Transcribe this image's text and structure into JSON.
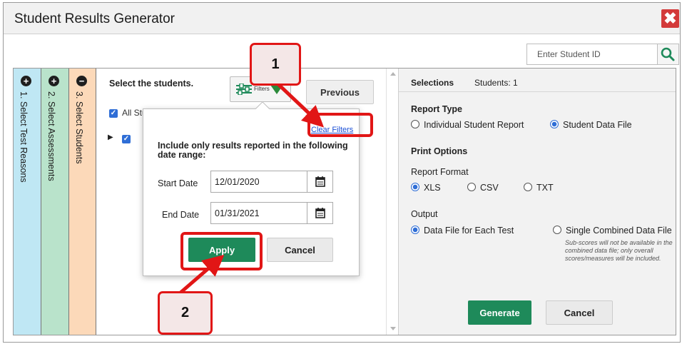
{
  "dialog": {
    "title": "Student Results Generator",
    "close_symbol": "✖"
  },
  "search": {
    "placeholder": "Enter Student ID"
  },
  "steps": [
    {
      "icon": "plus-icon",
      "symbol": "+",
      "label": "1. Select Test Reasons",
      "color": "#bfe7f4"
    },
    {
      "icon": "plus-icon",
      "symbol": "+",
      "label": "2. Select Assessments",
      "color": "#b9e3cb"
    },
    {
      "icon": "minus-icon",
      "symbol": "−",
      "label": "3. Select Students",
      "color": "#fcd9b9"
    }
  ],
  "students": {
    "title": "Select the students.",
    "filter_label": "Filters",
    "previous_label": "Previous",
    "all_students_label": "All Students"
  },
  "filter_popup": {
    "clear_filters": "Clear Filters",
    "include_text": "Include only results reported in the following date range:",
    "start_label": "Start Date",
    "start_value": "12/01/2020",
    "end_label": "End Date",
    "end_value": "01/31/2021",
    "apply_label": "Apply",
    "cancel_label": "Cancel"
  },
  "selections": {
    "title": "Selections",
    "students_count": "Students: 1",
    "report_type_title": "Report Type",
    "report_types": [
      {
        "label": "Individual Student Report",
        "selected": false
      },
      {
        "label": "Student Data File",
        "selected": true
      }
    ],
    "print_options_title": "Print Options",
    "report_format_title": "Report Format",
    "formats": [
      {
        "label": "XLS",
        "selected": true
      },
      {
        "label": "CSV",
        "selected": false
      },
      {
        "label": "TXT",
        "selected": false
      }
    ],
    "output_title": "Output",
    "outputs": [
      {
        "label": "Data File for Each Test",
        "selected": true
      },
      {
        "label": "Single Combined Data File",
        "selected": false
      }
    ],
    "note": "Sub-scores will not be available in the combined data file; only overall scores/measures will be included.",
    "generate_label": "Generate",
    "cancel_label": "Cancel"
  },
  "callouts": {
    "one": "1",
    "two": "2"
  },
  "colors": {
    "accent_green": "#1e8a5a",
    "highlight_red": "#e11616",
    "checkbox_blue": "#2f6ed6",
    "close_red": "#d33a3a"
  }
}
